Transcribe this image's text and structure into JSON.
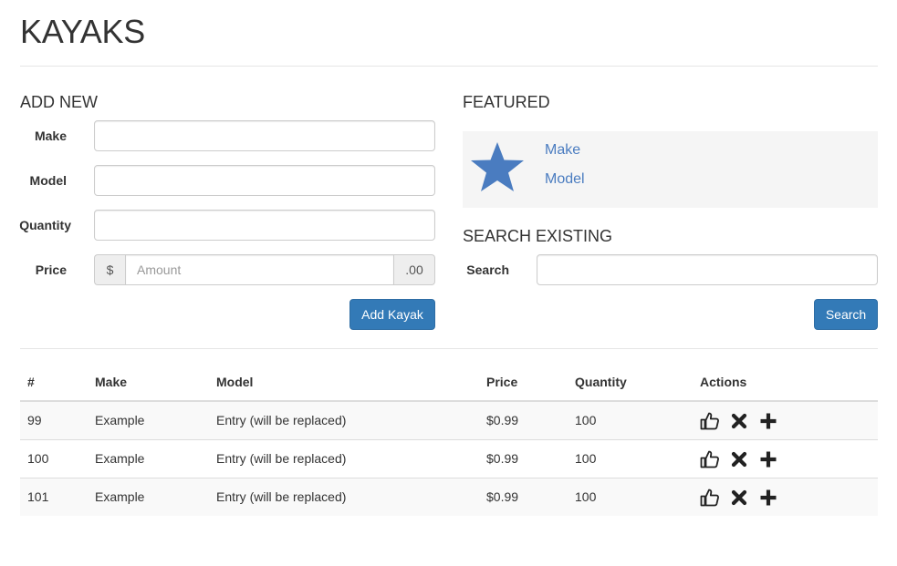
{
  "page": {
    "title": "KAYAKS"
  },
  "add_new": {
    "title": "ADD NEW",
    "make_label": "Make",
    "model_label": "Model",
    "quantity_label": "Quantity",
    "price_label": "Price",
    "price_prefix": "$",
    "price_placeholder": "Amount",
    "price_suffix": ".00",
    "make_value": "",
    "model_value": "",
    "quantity_value": "",
    "submit_label": "Add Kayak"
  },
  "featured": {
    "title": "FEATURED",
    "icon": "star-icon",
    "make_link": "Make",
    "model_link": "Model",
    "star_color": "#4a7cc0"
  },
  "search": {
    "title": "SEARCH EXISTING",
    "label": "Search",
    "value": "",
    "button_label": "Search"
  },
  "table": {
    "headers": [
      "#",
      "Make",
      "Model",
      "Price",
      "Quantity",
      "Actions"
    ],
    "rows": [
      {
        "id": "99",
        "make": "Example",
        "model": "Entry (will be replaced)",
        "price": "$0.99",
        "quantity": "100"
      },
      {
        "id": "100",
        "make": "Example",
        "model": "Entry (will be replaced)",
        "price": "$0.99",
        "quantity": "100"
      },
      {
        "id": "101",
        "make": "Example",
        "model": "Entry (will be replaced)",
        "price": "$0.99",
        "quantity": "100"
      }
    ],
    "action_icons": [
      "thumbs-up-icon",
      "remove-icon",
      "plus-icon"
    ]
  },
  "colors": {
    "primary": "#337ab7",
    "link": "#4a7cc0"
  }
}
